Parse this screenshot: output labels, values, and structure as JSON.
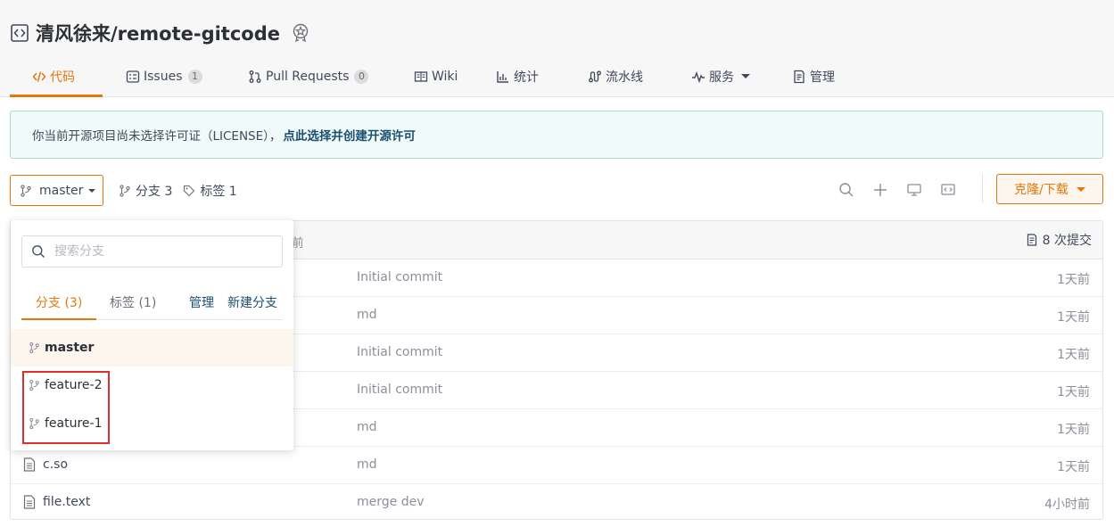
{
  "repo": {
    "title": "清风徐来/remote-gitcode"
  },
  "tabs": [
    {
      "label": "代码",
      "icon": "code-icon",
      "active": true
    },
    {
      "label": "Issues",
      "icon": "issues-icon",
      "count": "1"
    },
    {
      "label": "Pull Requests",
      "icon": "pull-request-icon",
      "count": "0"
    },
    {
      "label": "Wiki",
      "icon": "wiki-icon"
    },
    {
      "label": "统计",
      "icon": "stats-icon"
    },
    {
      "label": "流水线",
      "icon": "pipeline-icon"
    },
    {
      "label": "服务",
      "icon": "service-icon"
    },
    {
      "label": "管理",
      "icon": "manage-icon"
    }
  ],
  "notice": {
    "text": "你当前开源项目尚未选择许可证（LICENSE），",
    "link": "点此选择并创建开源许可"
  },
  "branch": {
    "current": "master",
    "branches_label": "分支 3",
    "tags_label": "标签 1"
  },
  "clone": {
    "label": "克隆/下载"
  },
  "table": {
    "head_time": "前",
    "commit_count": "8 次提交",
    "rows": [
      {
        "name": "",
        "message": "Initial commit",
        "time": "1天前"
      },
      {
        "name": "",
        "message": "md",
        "time": "1天前"
      },
      {
        "name": "",
        "message": "Initial commit",
        "time": "1天前"
      },
      {
        "name": "",
        "message": "Initial commit",
        "time": "1天前"
      },
      {
        "name": "",
        "message": "md",
        "time": "1天前"
      },
      {
        "name": "c.so",
        "message": "md",
        "time": "1天前"
      },
      {
        "name": "file.text",
        "message": "merge dev",
        "time": "4小时前"
      }
    ]
  },
  "dropdown": {
    "search_placeholder": "搜索分支",
    "tab_branches": "分支 (3)",
    "tab_tags": "标签 (1)",
    "manage": "管理",
    "new_branch": "新建分支",
    "branches": [
      "master",
      "feature-2",
      "feature-1"
    ]
  },
  "colors": {
    "accent": "#e4770c",
    "link": "#1b4f6f",
    "highlight": "#e02c2c"
  }
}
